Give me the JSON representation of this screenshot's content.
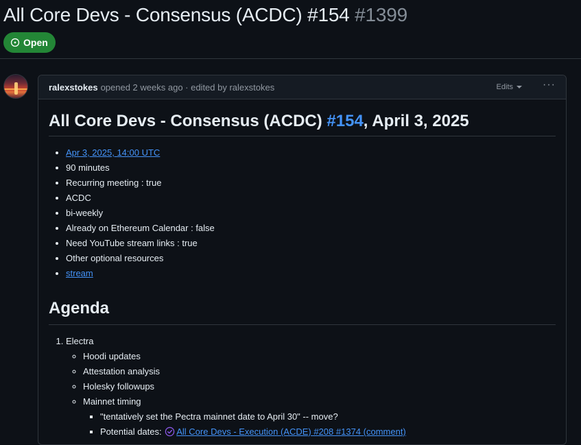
{
  "issue": {
    "title": "All Core Devs - Consensus (ACDC) #154",
    "number": "#1399",
    "state": "Open"
  },
  "comment": {
    "author": "ralexstokes",
    "meta": "opened 2 weeks ago · edited by ralexstokes",
    "edits_label": "Edits",
    "menu_glyph": "···"
  },
  "body": {
    "heading_prefix": "All Core Devs - Consensus (ACDC) ",
    "heading_link": "#154",
    "heading_suffix": ", April 3, 2025",
    "info": [
      "Apr 3, 2025, 14:00 UTC",
      "90 minutes",
      "Recurring meeting : true",
      "ACDC",
      "bi-weekly",
      "Already on Ethereum Calendar : false",
      "Need YouTube stream links : true",
      "Other optional resources",
      "stream"
    ],
    "agenda_heading": "Agenda",
    "agenda": {
      "item1": "Electra",
      "sub": [
        "Hoodi updates",
        "Attestation analysis",
        "Holesky followups",
        "Mainnet timing"
      ],
      "mainnet": {
        "quote": "\"tentatively set the Pectra mainnet date to April 30\" -- move?",
        "potential_label": "Potential dates: ",
        "potential_link": "All Core Devs - Execution (ACDE) #208 #1374 (comment)"
      }
    }
  },
  "colors": {
    "badge": "#238636",
    "link": "#4493f8",
    "background": "#0d1117",
    "check": "#8957e5"
  }
}
